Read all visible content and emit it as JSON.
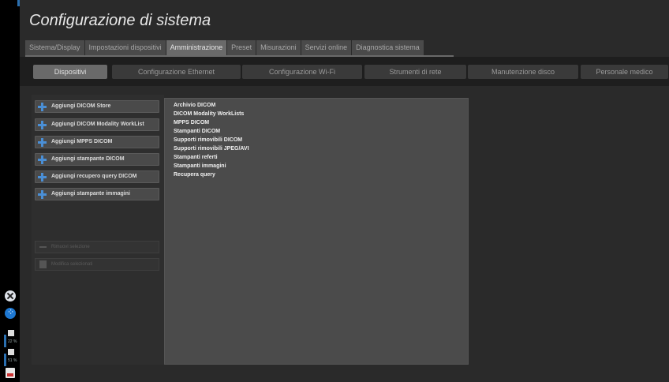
{
  "title": "Configurazione di sistema",
  "tabs": [
    {
      "label": "Sistema/Display"
    },
    {
      "label": "Impostazioni dispositivi"
    },
    {
      "label": "Amministrazione"
    },
    {
      "label": "Preset"
    },
    {
      "label": "Misurazioni"
    },
    {
      "label": "Servizi online"
    },
    {
      "label": "Diagnostica sistema"
    }
  ],
  "active_tab": "Amministrazione",
  "subtabs": [
    {
      "label": "Dispositivi"
    },
    {
      "label": "Configurazione Ethernet"
    },
    {
      "label": "Configurazione Wi-Fi"
    },
    {
      "label": "Strumenti di rete"
    },
    {
      "label": "Manutenzione disco"
    },
    {
      "label": "Personale medico"
    }
  ],
  "active_subtab": "Dispositivi",
  "add_buttons": [
    {
      "label": "Aggiungi DICOM Store"
    },
    {
      "label": "Aggiungi DICOM Modality WorkList"
    },
    {
      "label": "Aggiungi MPPS DICOM"
    },
    {
      "label": "Aggiungi stampante DICOM"
    },
    {
      "label": "Aggiungi recupero query DICOM"
    },
    {
      "label": "Aggiungi stampante immagini"
    }
  ],
  "remove_button": {
    "label": "Rimuovi selezione",
    "enabled": false
  },
  "edit_button": {
    "label": "Modifica selezionati",
    "enabled": false
  },
  "device_list": [
    "Archivio DICOM",
    "DICOM Modality WorkLists",
    "MPPS DICOM",
    "Stampanti DICOM",
    "Supporti rimovibili DICOM",
    "Supporti rimovibili JPEG/AVI",
    "Stampanti referti",
    "Stampanti immagini",
    "Recupera query"
  ],
  "status": {
    "meter1_text": "22 %",
    "meter2_text": "51 %"
  },
  "colors": {
    "accent": "#4a8fd6",
    "active_tab": "#6a6a6a",
    "background": "#2a2a2a"
  },
  "icons": {
    "close": "close-icon",
    "usb": "usb-icon",
    "add": "plus-icon",
    "remove": "minus-icon",
    "edit": "edit-icon",
    "printer": "printer-icon"
  }
}
